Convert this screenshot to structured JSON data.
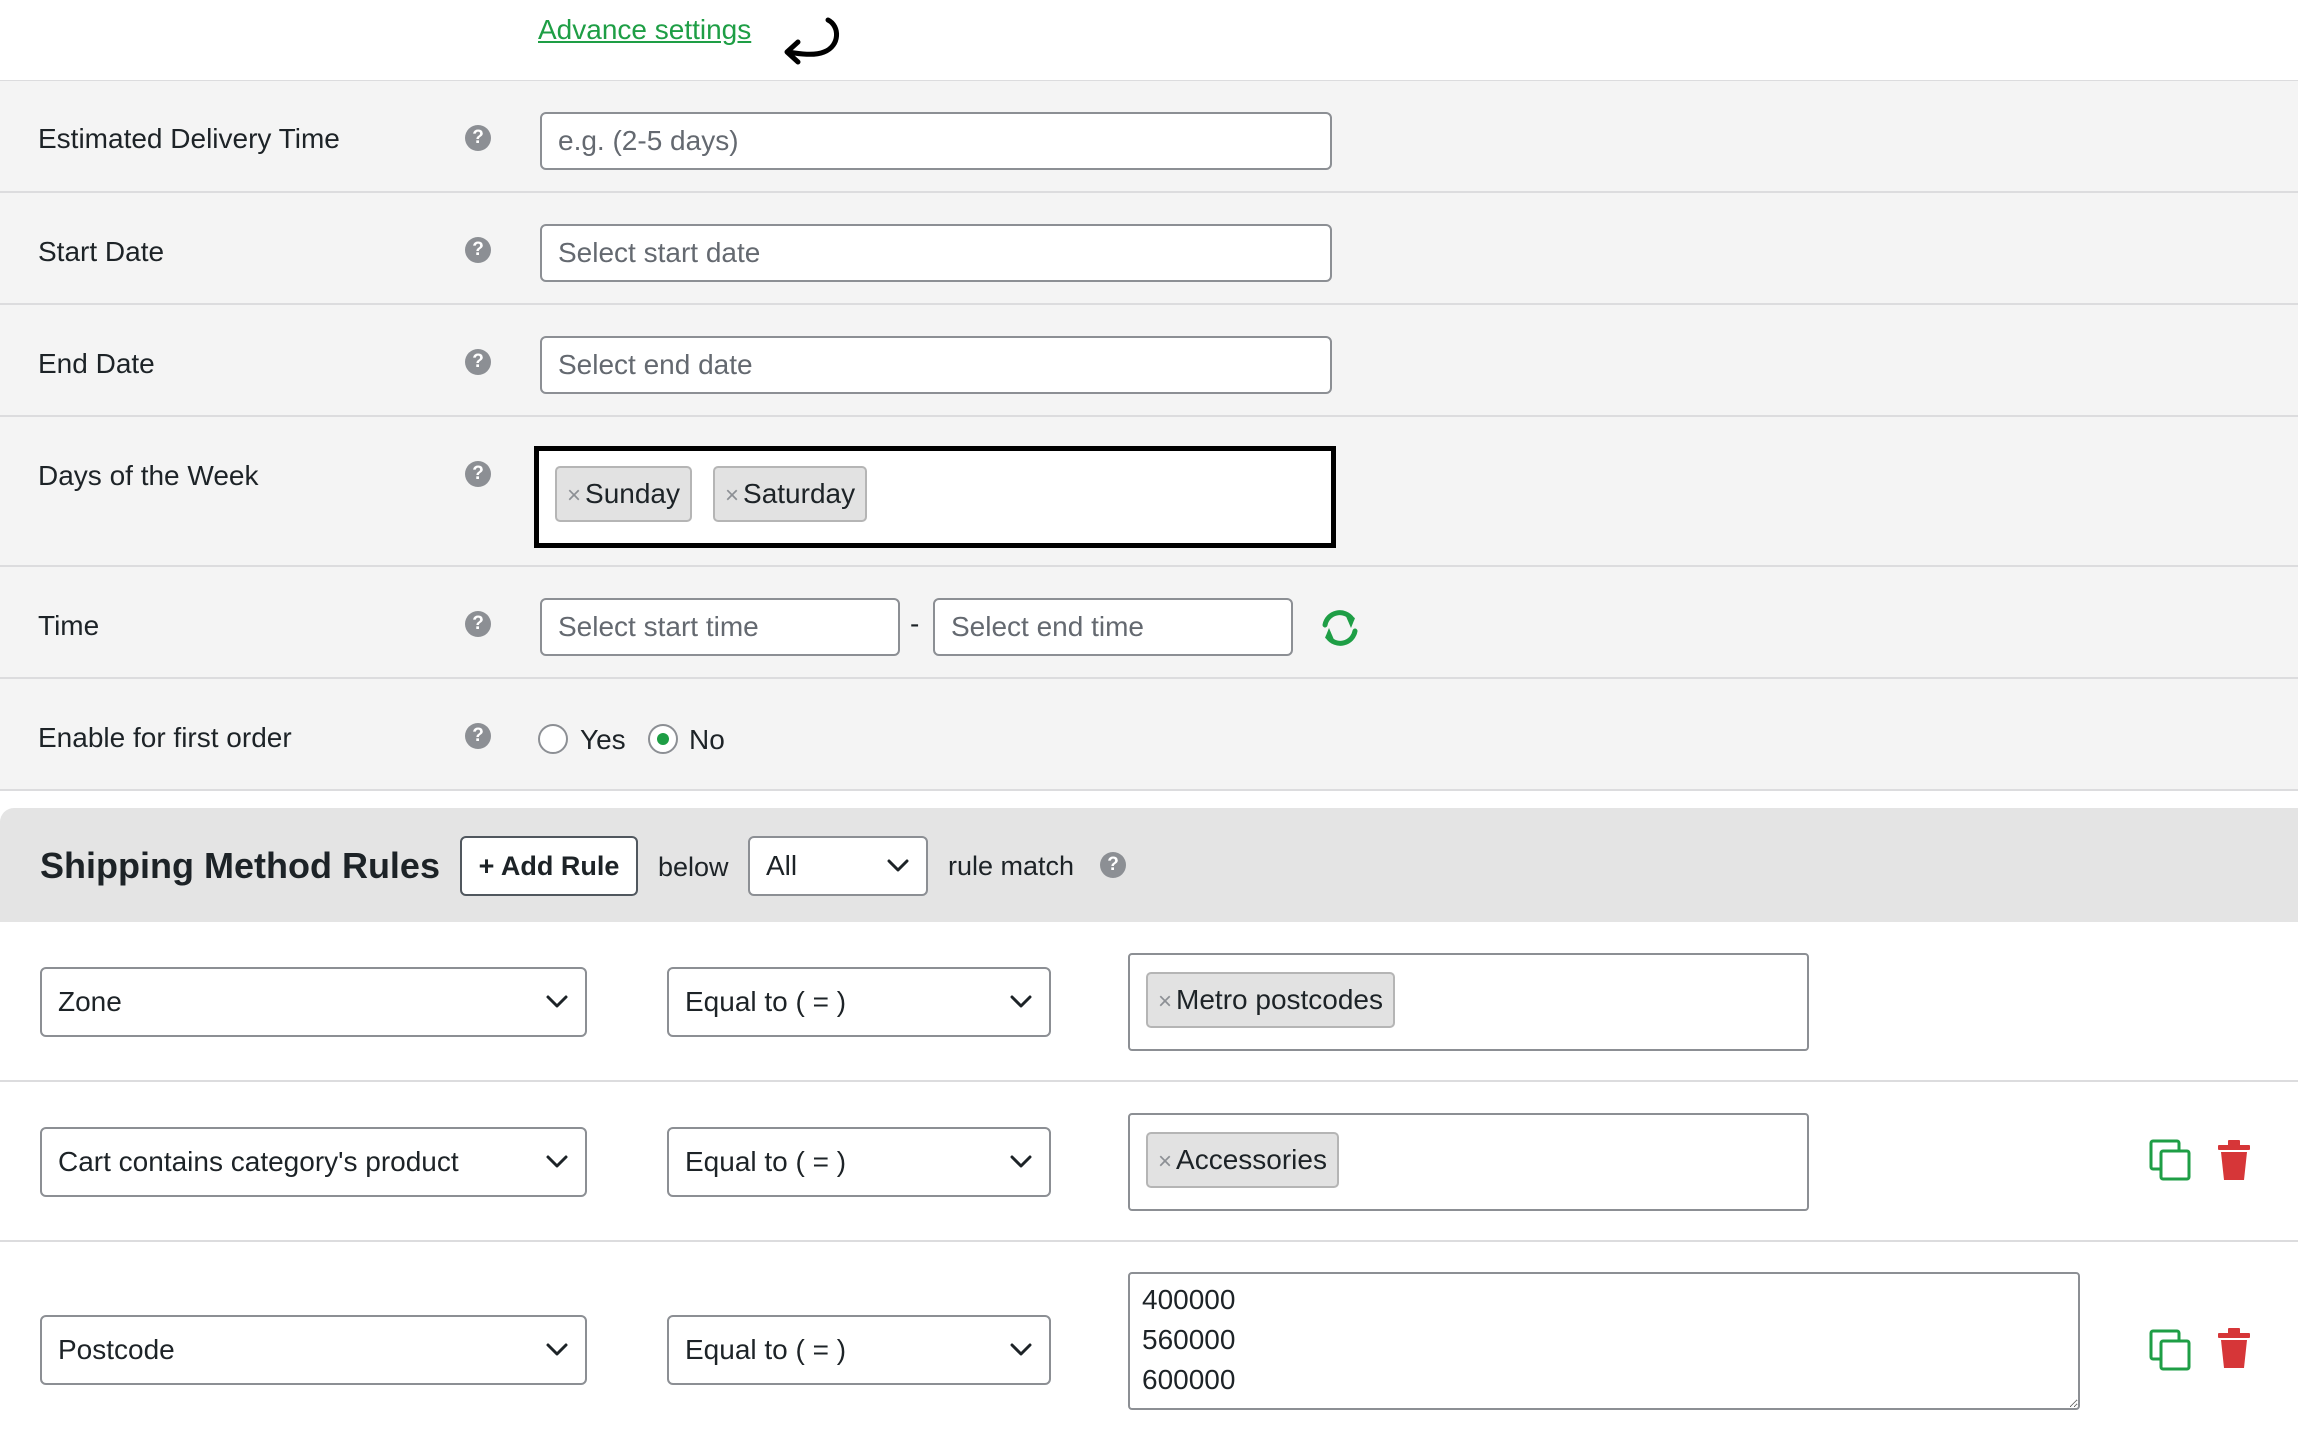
{
  "advance_link": "Advance settings",
  "settings": {
    "delivery_time": {
      "label": "Estimated Delivery Time",
      "placeholder": "e.g. (2-5 days)"
    },
    "start_date": {
      "label": "Start Date",
      "placeholder": "Select start date"
    },
    "end_date": {
      "label": "End Date",
      "placeholder": "Select end date"
    },
    "days": {
      "label": "Days of the Week",
      "chips": [
        "Sunday",
        "Saturday"
      ]
    },
    "time": {
      "label": "Time",
      "start_placeholder": "Select start time",
      "separator": "-",
      "end_placeholder": "Select end time"
    },
    "first_order": {
      "label": "Enable for first order",
      "options": [
        "Yes",
        "No"
      ],
      "selected": "No"
    },
    "help_glyph": "?"
  },
  "rules": {
    "title": "Shipping Method Rules",
    "add_rule": "+ Add Rule",
    "below": "below",
    "match_value": "All",
    "match_suffix": "rule match",
    "rows": [
      {
        "condition": "Zone",
        "operator": "Equal to ( = )",
        "tags": [
          "Metro postcodes"
        ]
      },
      {
        "condition": "Cart contains category's product",
        "operator": "Equal to ( = )",
        "tags": [
          "Accessories"
        ]
      },
      {
        "condition": "Postcode",
        "operator": "Equal to ( = )",
        "textarea": "400000\n560000\n600000"
      }
    ]
  },
  "colors": {
    "accent": "#1e9e45",
    "danger": "#d63638",
    "row_bg": "#f4f4f4",
    "header_bg": "#e4e4e4"
  },
  "chip_remove_glyph": "×"
}
